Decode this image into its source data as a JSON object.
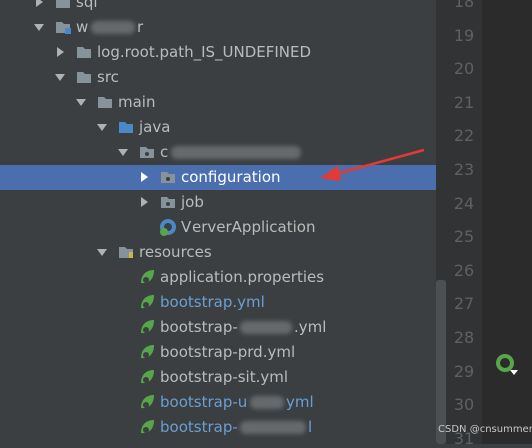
{
  "tree": [
    {
      "label": "sql",
      "icon": "folder-icon",
      "arrow": "collapsed"
    },
    {
      "label": "w",
      "label_suffix": "r",
      "icon": "module-folder-icon",
      "arrow": "expanded"
    },
    {
      "label": "log.root.path_IS_UNDEFINED",
      "icon": "folder-icon",
      "arrow": "collapsed"
    },
    {
      "label": "src",
      "icon": "folder-icon",
      "arrow": "expanded"
    },
    {
      "label": "main",
      "icon": "folder-icon",
      "arrow": "expanded"
    },
    {
      "label": "java",
      "icon": "source-folder-icon",
      "arrow": "expanded"
    },
    {
      "label": "c",
      "icon": "package-icon",
      "arrow": "expanded"
    },
    {
      "label": "configuration",
      "icon": "package-icon",
      "arrow": "collapsed",
      "selected": true
    },
    {
      "label": "job",
      "icon": "package-icon",
      "arrow": "collapsed"
    },
    {
      "label": "erverApplication",
      "label_prefix": "V",
      "icon": "spring-boot-class-icon",
      "arrow": "none"
    },
    {
      "label": "resources",
      "icon": "resources-folder-icon",
      "arrow": "expanded"
    },
    {
      "label": "application.properties",
      "icon": "spring-properties-icon",
      "arrow": "none"
    },
    {
      "label": "bootstrap.yml",
      "icon": "spring-yml-icon",
      "arrow": "none",
      "color": "blue"
    },
    {
      "label": "bootstrap-",
      "label_suffix": ".yml",
      "icon": "spring-yml-icon",
      "arrow": "none"
    },
    {
      "label": "bootstrap-prd.yml",
      "icon": "spring-yml-icon",
      "arrow": "none"
    },
    {
      "label": "bootstrap-sit.yml",
      "icon": "spring-yml-icon",
      "arrow": "none"
    },
    {
      "label": "bootstrap-u",
      "label_suffix": "yml",
      "icon": "spring-yml-icon",
      "arrow": "none",
      "color": "blue"
    },
    {
      "label": "bootstrap-",
      "label_suffix": "l",
      "icon": "spring-yml-icon",
      "arrow": "none",
      "color": "blue"
    }
  ],
  "line_numbers": [
    "18",
    "19",
    "20",
    "21",
    "22",
    "23",
    "24",
    "25",
    "26",
    "27",
    "28",
    "29",
    "30",
    "31"
  ],
  "watermark": "CSDN @cnsummerLi",
  "colors": {
    "panel_bg": "#3c3f41",
    "selection": "#4b6eaf",
    "text": "#bbbbbb",
    "modified_text": "#6a9fd4",
    "annotation_arrow": "#e53935"
  }
}
